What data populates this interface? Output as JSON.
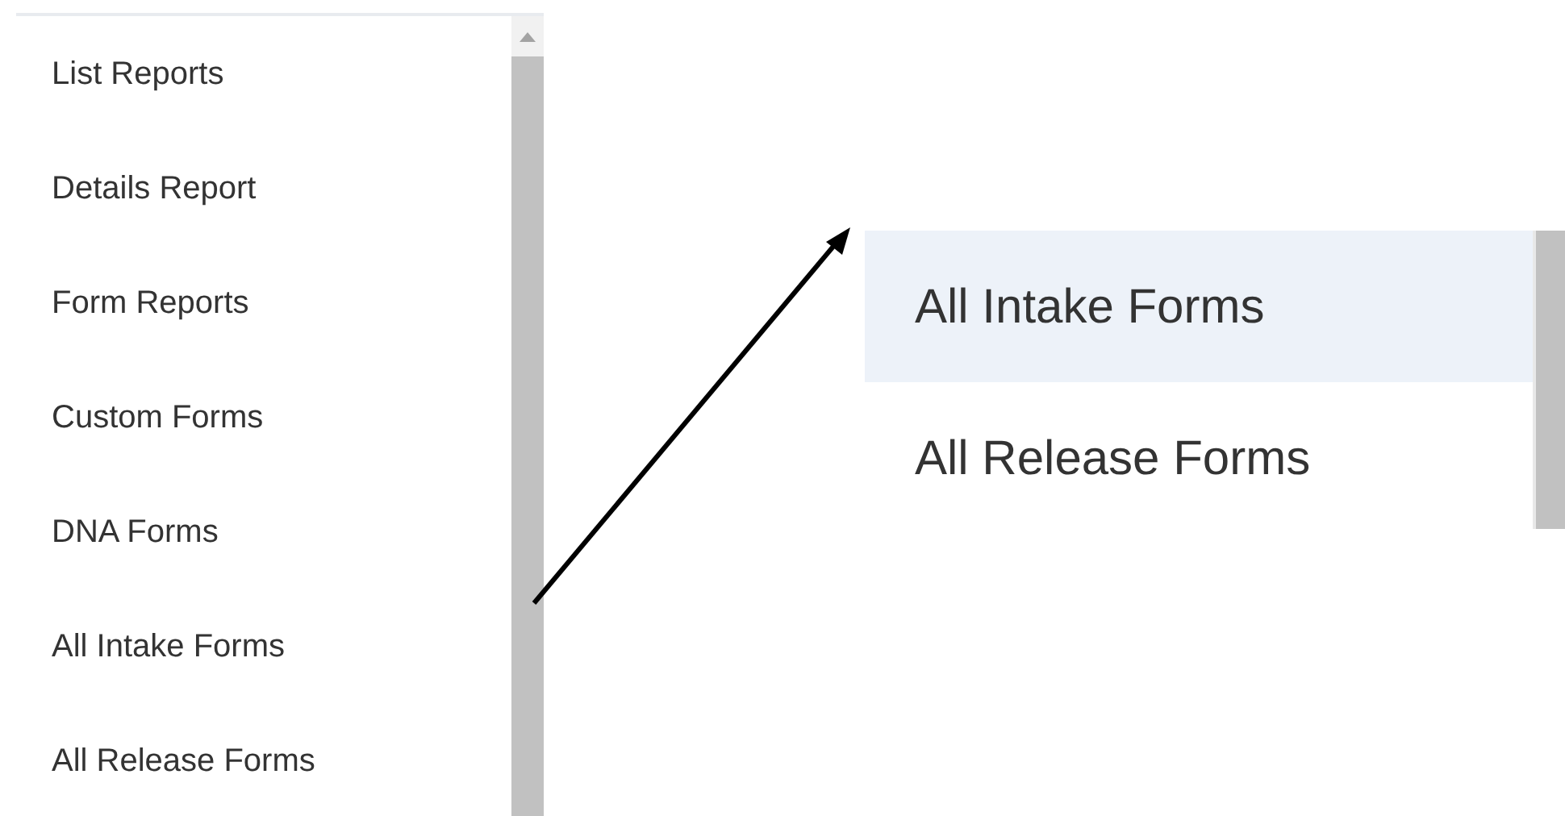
{
  "menu": {
    "items": [
      {
        "label": "List Reports",
        "selected": false
      },
      {
        "label": "Details Report",
        "selected": false
      },
      {
        "label": "Form Reports",
        "selected": false
      },
      {
        "label": "Custom Forms",
        "selected": false
      },
      {
        "label": "DNA Forms",
        "selected": false
      },
      {
        "label": "All Intake Forms",
        "selected": false
      },
      {
        "label": "All Release Forms",
        "selected": false
      }
    ]
  },
  "zoomed_menu": {
    "items": [
      {
        "label": "All Intake Forms",
        "selected": true
      },
      {
        "label": "All Release Forms",
        "selected": false
      }
    ]
  }
}
